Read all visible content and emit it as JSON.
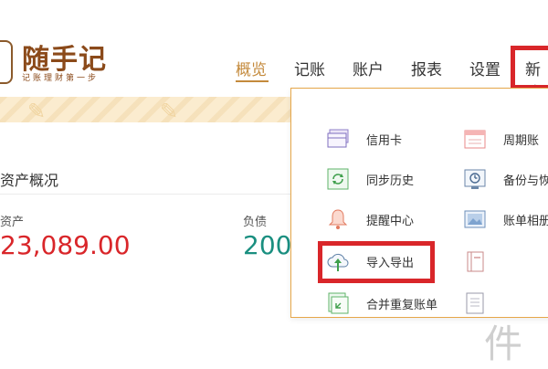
{
  "header": {
    "logo_title": "随手记",
    "logo_slogan": "记账理财第一步",
    "nav": [
      {
        "label": "概览",
        "active": true
      },
      {
        "label": "记账"
      },
      {
        "label": "账户"
      },
      {
        "label": "报表"
      },
      {
        "label": "设置"
      },
      {
        "label": "新功"
      }
    ]
  },
  "overview": {
    "section_title": "资产概况",
    "assets_label": "资产",
    "assets_value": "23,089.00",
    "liabilities_label": "负债",
    "liabilities_value": "200"
  },
  "dropdown": {
    "items": [
      {
        "label": "信用卡",
        "icon": "credit-card-icon"
      },
      {
        "label": "周期账",
        "icon": "calendar-icon"
      },
      {
        "label": "同步历史",
        "icon": "sync-icon"
      },
      {
        "label": "备份与恢",
        "icon": "backup-restore-icon"
      },
      {
        "label": "提醒中心",
        "icon": "bell-icon"
      },
      {
        "label": "账单相册",
        "icon": "photo-album-icon"
      },
      {
        "label": "导入导出",
        "icon": "cloud-upload-icon"
      },
      {
        "label": "",
        "icon": "book-icon"
      },
      {
        "label": "合并重复账单",
        "icon": "merge-icon"
      },
      {
        "label": "",
        "icon": "document-icon"
      }
    ]
  },
  "watermark": "软件",
  "colors": {
    "accent": "#c48a3c",
    "highlight": "#d9262a",
    "assets": "#d9262a",
    "liabilities": "#1a8f80",
    "banner": "#fbeccf"
  }
}
